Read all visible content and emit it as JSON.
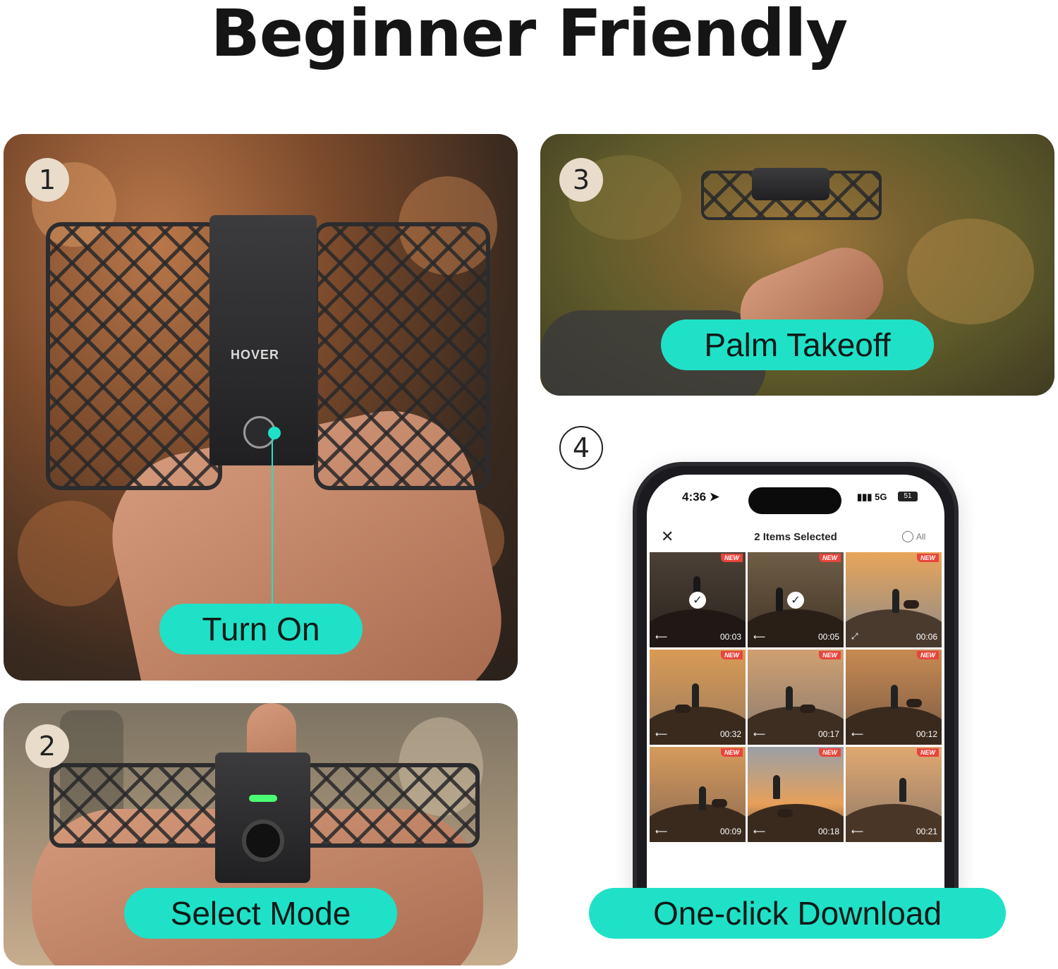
{
  "title": "Beginner Friendly",
  "accent_color": "#1fe1c7",
  "steps": [
    {
      "number": "1",
      "label": "Turn On"
    },
    {
      "number": "2",
      "label": "Select Mode"
    },
    {
      "number": "3",
      "label": "Palm Takeoff"
    },
    {
      "number": "4",
      "label": "One-click Download"
    }
  ],
  "drone": {
    "brand": "HOVER"
  },
  "phone": {
    "time": "4:36",
    "network": "5G",
    "battery": "51",
    "header_title": "2 Items Selected",
    "select_all_label": "All",
    "thumbnails": [
      {
        "duration": "00:03",
        "new": "NEW",
        "selected": true
      },
      {
        "duration": "00:05",
        "new": "NEW",
        "selected": true
      },
      {
        "duration": "00:06",
        "new": "NEW",
        "selected": false
      },
      {
        "duration": "00:32",
        "new": "NEW",
        "selected": false
      },
      {
        "duration": "00:17",
        "new": "NEW",
        "selected": false
      },
      {
        "duration": "00:12",
        "new": "NEW",
        "selected": false
      },
      {
        "duration": "00:09",
        "new": "NEW",
        "selected": false
      },
      {
        "duration": "00:18",
        "new": "NEW",
        "selected": false
      },
      {
        "duration": "00:21",
        "new": "NEW",
        "selected": false
      }
    ]
  }
}
